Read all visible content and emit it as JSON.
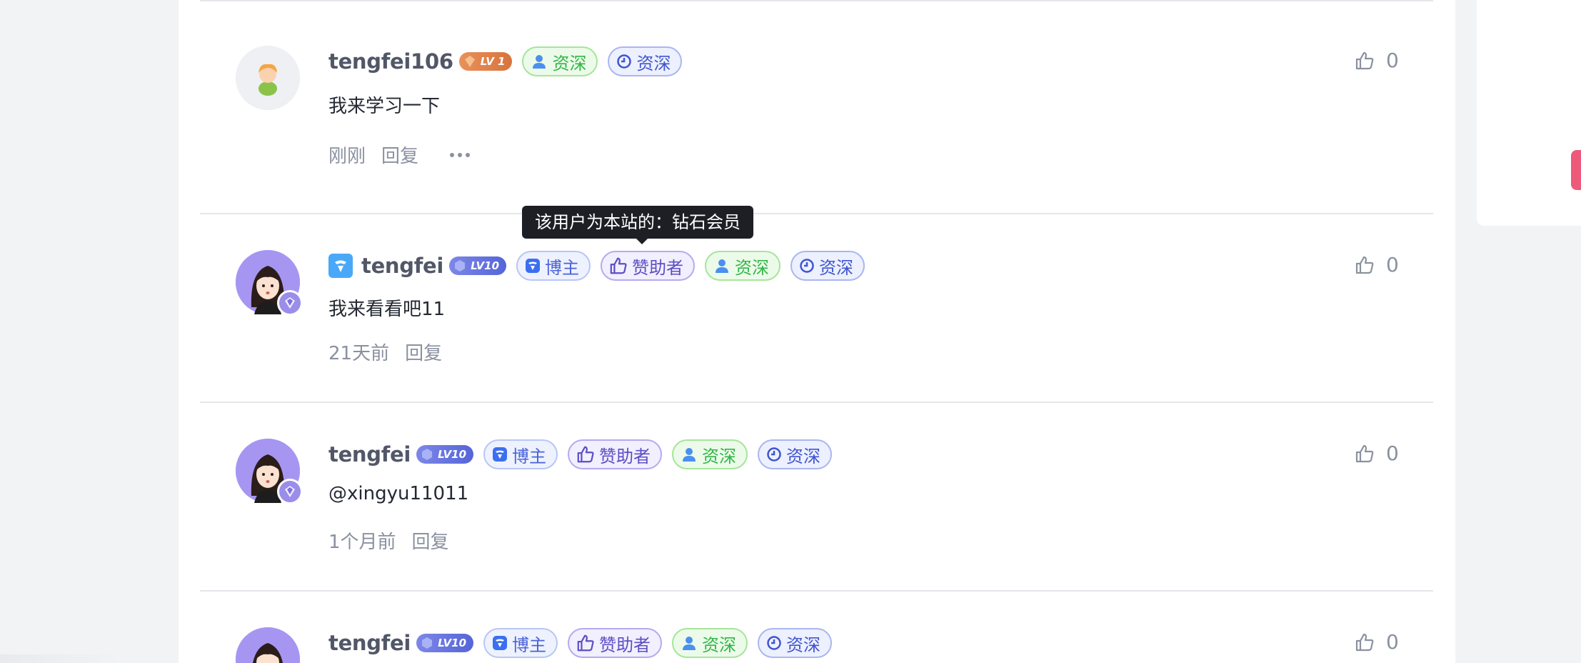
{
  "tooltip": {
    "text": "该用户为本站的：钻石会员"
  },
  "comments": [
    {
      "username": "tengfei106",
      "level": "LV 1",
      "tags": [
        "资深",
        "资深"
      ],
      "content": "我来学习一下",
      "time": "刚刚",
      "reply_label": "回复",
      "likes": "0"
    },
    {
      "username": "tengfei",
      "level": "LV10",
      "tags": [
        "博主",
        "赞助者",
        "资深",
        "资深"
      ],
      "content": "我来看看吧11",
      "time": "21天前",
      "reply_label": "回复",
      "likes": "0"
    },
    {
      "username": "tengfei",
      "level": "LV10",
      "tags": [
        "博主",
        "赞助者",
        "资深",
        "资深"
      ],
      "content": "@xingyu11011",
      "time": "1个月前",
      "reply_label": "回复",
      "likes": "0"
    },
    {
      "username": "tengfei",
      "level": "LV10",
      "tags": [
        "博主",
        "赞助者",
        "资深",
        "资深"
      ],
      "likes": "0"
    }
  ],
  "icons": {
    "like": "thumbs-up-icon",
    "more": "more-dots-icon",
    "vip": "diamond-icon",
    "site": "site-logo-icon"
  },
  "colors": {
    "lv1": "#d8733d",
    "lv10": "#5565d8",
    "tooltip_bg": "#1d1f24",
    "accent": "#ee5a7a"
  }
}
